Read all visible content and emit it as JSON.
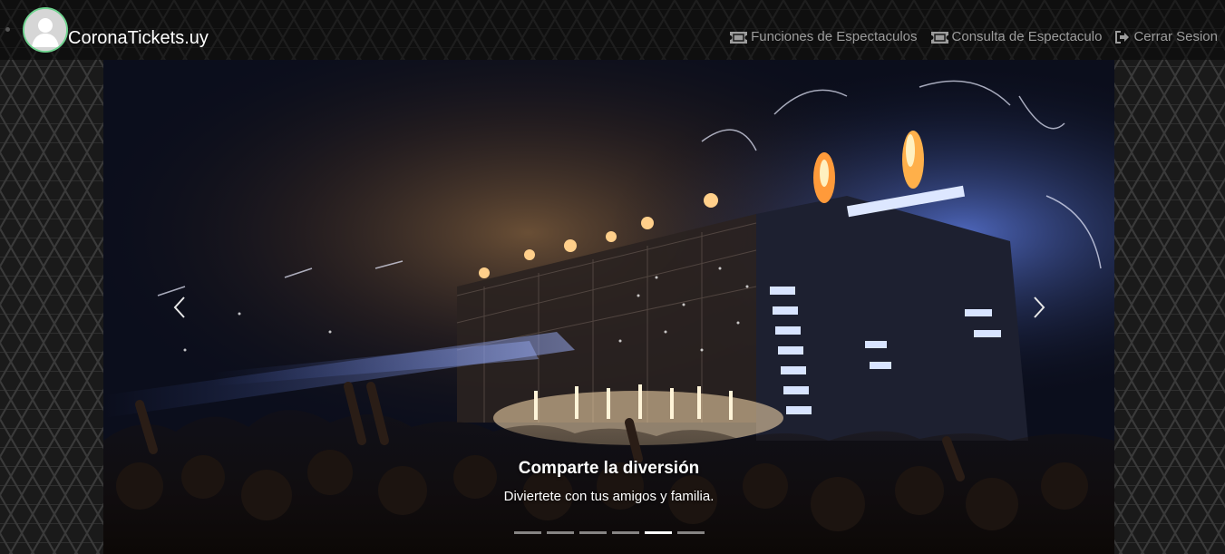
{
  "brand": {
    "name": "CoronaTickets.uy",
    "avatar_icon": "user-avatar-icon"
  },
  "nav": {
    "items": [
      {
        "label": "Funciones de Espectaculos",
        "icon": "ticket-icon"
      },
      {
        "label": "Consulta de Espectaculo",
        "icon": "ticket-icon"
      },
      {
        "label": "Cerrar Sesion",
        "icon": "log-out-icon"
      }
    ]
  },
  "carousel": {
    "caption_title": "Comparte la diversión",
    "caption_text": "Diviertete con tus amigos y familia.",
    "indicator_count": 6,
    "active_index": 4
  },
  "colors": {
    "nav_text": "#9d9d9d",
    "brand_text": "#ffffff",
    "avatar_border": "#6fd38f",
    "page_background": "#1a1a1a"
  }
}
